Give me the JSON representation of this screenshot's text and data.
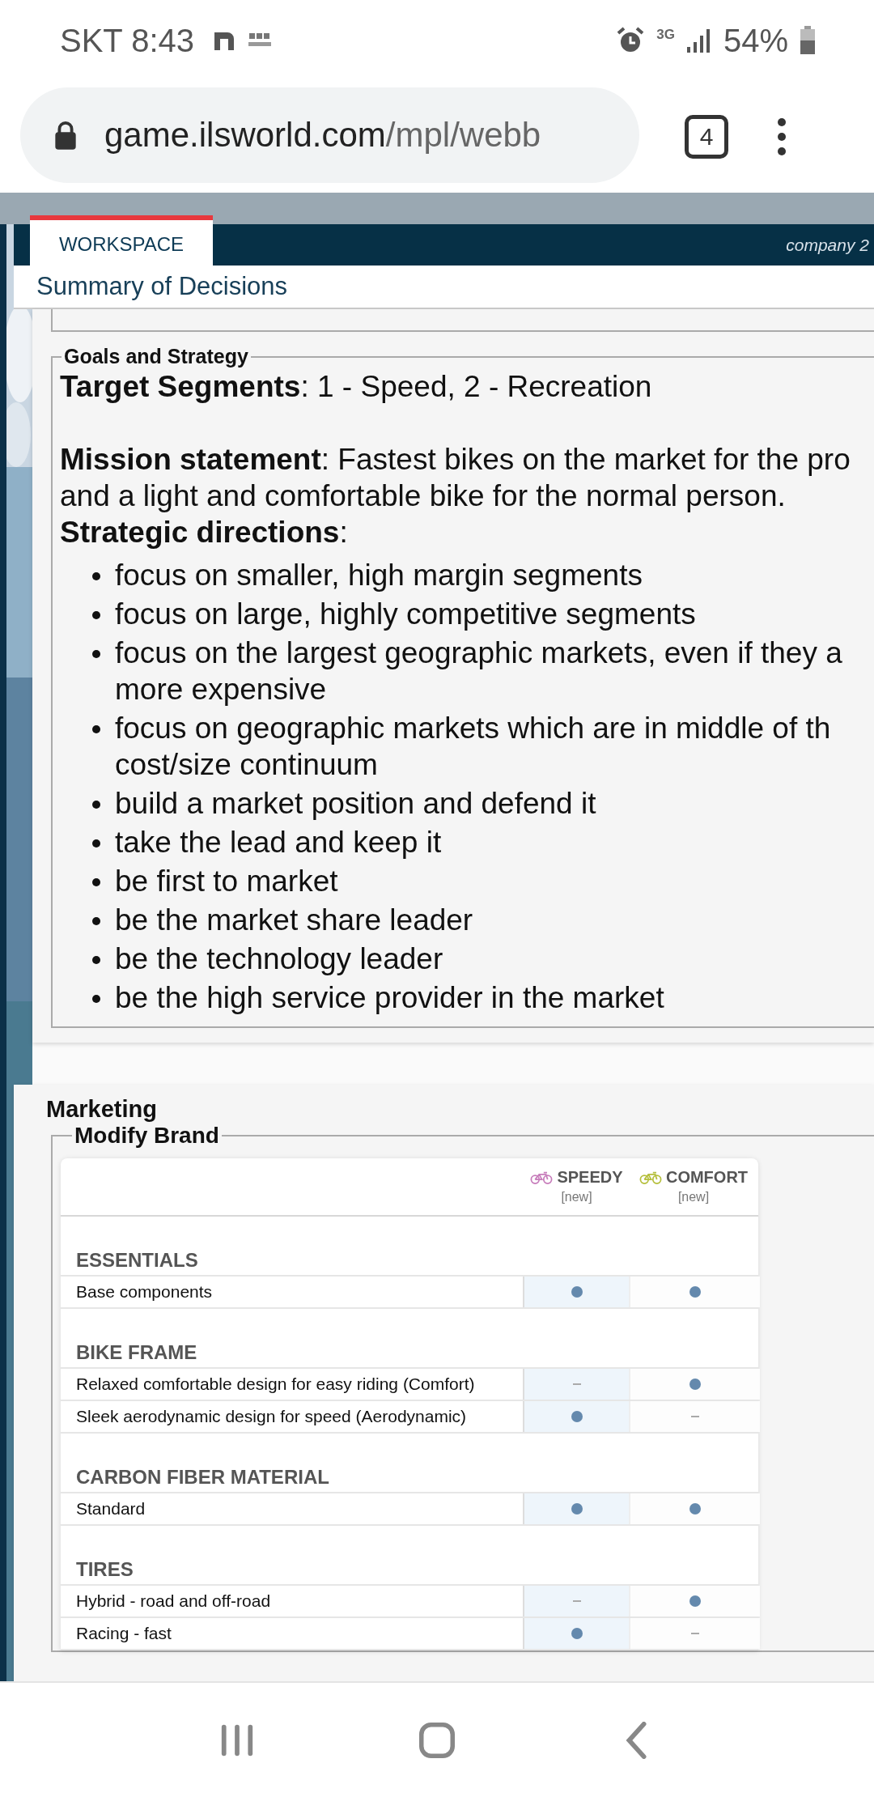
{
  "status_bar": {
    "carrier": "SKT",
    "time": "8:43",
    "network": "3G",
    "battery": "54%"
  },
  "browser": {
    "url_host": "game.ilsworld.com",
    "url_path": "/mpl/webb",
    "tab_count": "4"
  },
  "tabs": [
    {
      "label": "WORKSPACE",
      "selected": true
    }
  ],
  "header_right": "company 2",
  "page_title": "Summary of Decisions",
  "goals": {
    "legend": "Goals and Strategy",
    "target": "**Target Segments**: 1 - Speed, 2 - Recreation",
    "mission": "**Mission statement**: Fastest bikes on the market for the pro\nand a light and comfortable bike for the normal person.",
    "directions_label": "**Strategic directions**:",
    "directions": [
      "focus on smaller, high margin segments",
      "focus on large, highly competitive segments",
      "focus on the largest geographic markets, even if they a\nmore expensive",
      "focus on geographic markets which are in middle of th\ncost/size continuum",
      "build a market position and defend it",
      "take the lead and keep it",
      "be first to market",
      "be the market share leader",
      "be the technology leader",
      "be the high service provider in the market"
    ]
  },
  "marketing": {
    "title": "Marketing",
    "legend": "Modify Brand",
    "columns": [
      {
        "name": "SPEEDY",
        "note": "[new]",
        "color": "#c77dbb",
        "selected": true
      },
      {
        "name": "COMFORT",
        "note": "[new]",
        "color": "#b5bf3c",
        "selected": false
      }
    ],
    "groups": [
      {
        "title": "ESSENTIALS",
        "rows": [
          {
            "label": "Base components",
            "included": [
              true,
              true
            ]
          }
        ]
      },
      {
        "title": "BIKE FRAME",
        "rows": [
          {
            "label": "Relaxed comfortable design for easy riding (Comfort)",
            "included": [
              false,
              true
            ]
          },
          {
            "label": "Sleek aerodynamic design for speed (Aerodynamic)",
            "included": [
              true,
              false
            ]
          }
        ]
      },
      {
        "title": "CARBON FIBER MATERIAL",
        "rows": [
          {
            "label": "Standard",
            "included": [
              true,
              true
            ]
          }
        ]
      },
      {
        "title": "TIRES",
        "rows": [
          {
            "label": "Hybrid - road and off-road",
            "included": [
              false,
              true
            ]
          },
          {
            "label": "Racing - fast",
            "included": [
              true,
              false
            ]
          }
        ]
      }
    ]
  }
}
